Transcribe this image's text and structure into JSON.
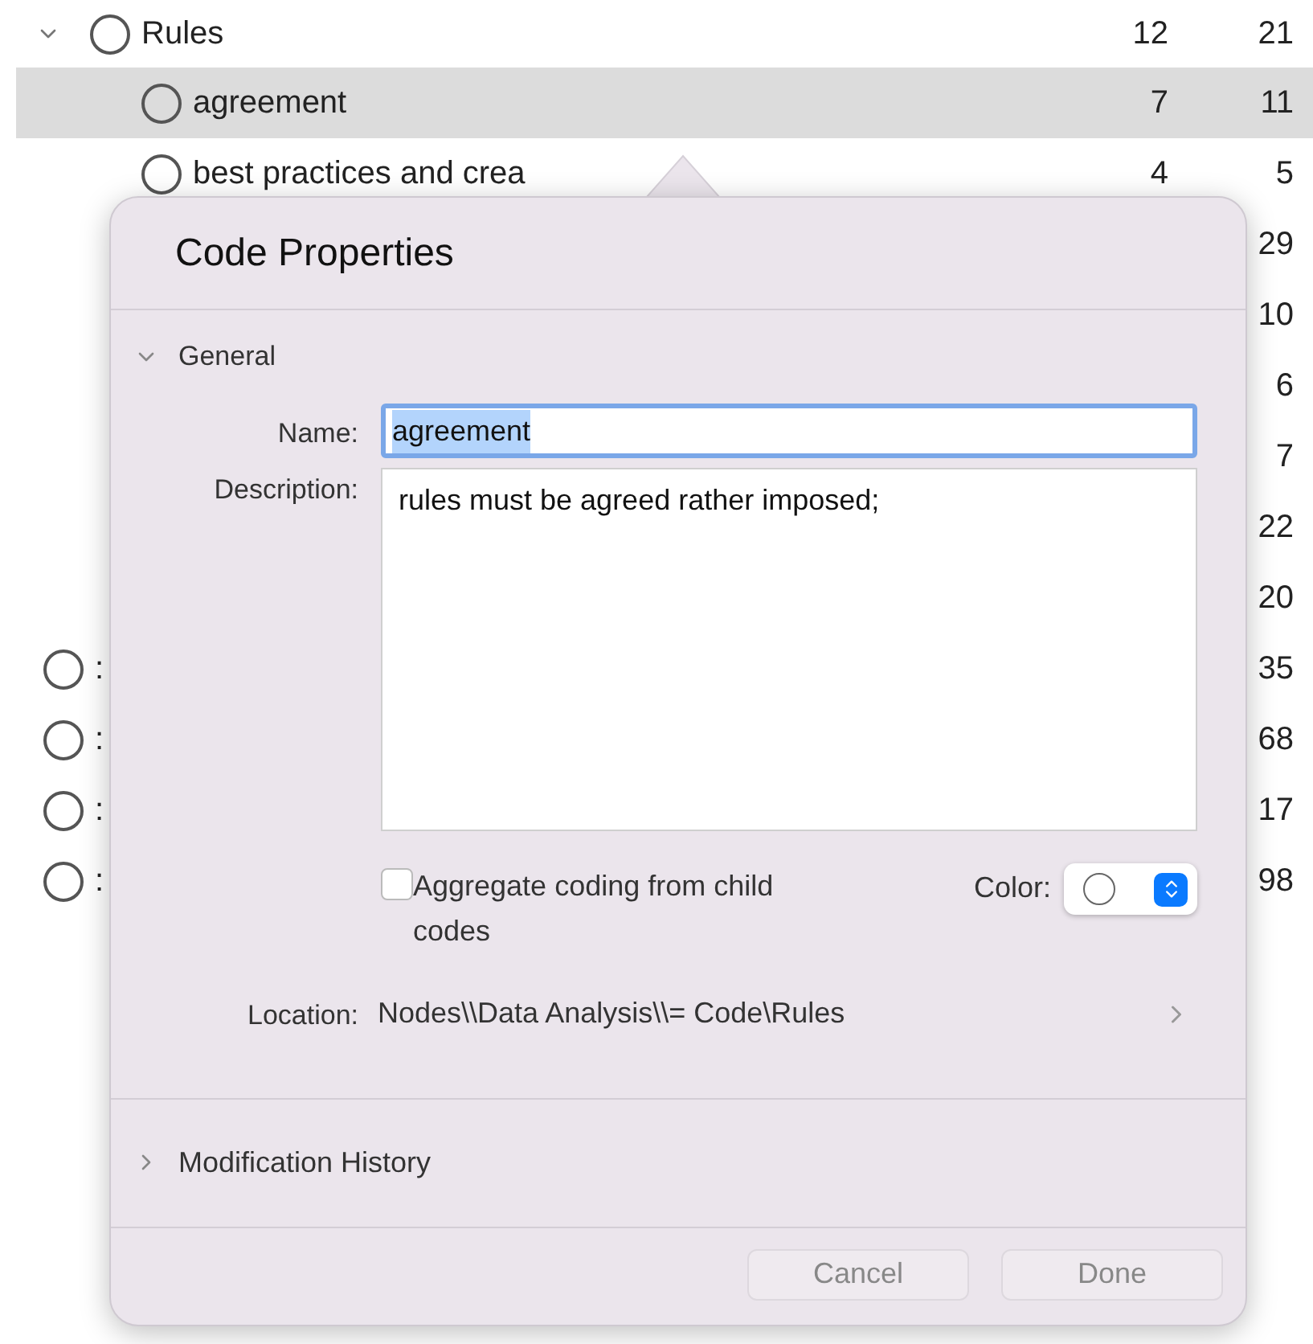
{
  "outline": {
    "rows": [
      {
        "name": "Rules",
        "column_1": "12",
        "column_2": "21",
        "expanded": true,
        "selected": false,
        "children": [
          {
            "name": "agreement",
            "column_1": "7",
            "column_2": "11",
            "selected": true
          },
          {
            "name": "best practices and crea",
            "column_1": "4",
            "column_2": "5",
            "selected": false
          },
          {
            "column_2": "29",
            "selected": false
          },
          {
            "column_2": "10",
            "selected": false
          },
          {
            "column_2": "6",
            "selected": false
          },
          {
            "column_2": "7",
            "selected": false
          },
          {
            "column_2": "22",
            "selected": false
          },
          {
            "column_2": "20",
            "selected": false
          }
        ]
      },
      {
        "name": ":",
        "column_2": "35",
        "selected": false
      },
      {
        "name": ":",
        "column_2": "68",
        "selected": false
      },
      {
        "name": ":",
        "column_2": "17",
        "selected": false
      },
      {
        "name": ":",
        "column_2": "98",
        "selected": false
      }
    ]
  },
  "popover": {
    "title": "Code Properties",
    "general": {
      "label": "General",
      "expanded": true,
      "name_label": "Name:",
      "name_value": "agreement",
      "text_selected": true,
      "description_label": "Description:",
      "description_value": "rules must be agreed rather imposed;",
      "aggregate": {
        "label": "Aggregate coding from child codes",
        "checked": false
      },
      "color_label": "Color:",
      "location_label": "Location:",
      "location_value": "Nodes\\\\Data Analysis\\\\= Code\\Rules"
    },
    "history": {
      "label": "Modification History",
      "expanded": false
    },
    "buttons": [
      {
        "label": "Cancel",
        "disabled": true
      },
      {
        "label": "Done",
        "disabled": true
      }
    ]
  }
}
